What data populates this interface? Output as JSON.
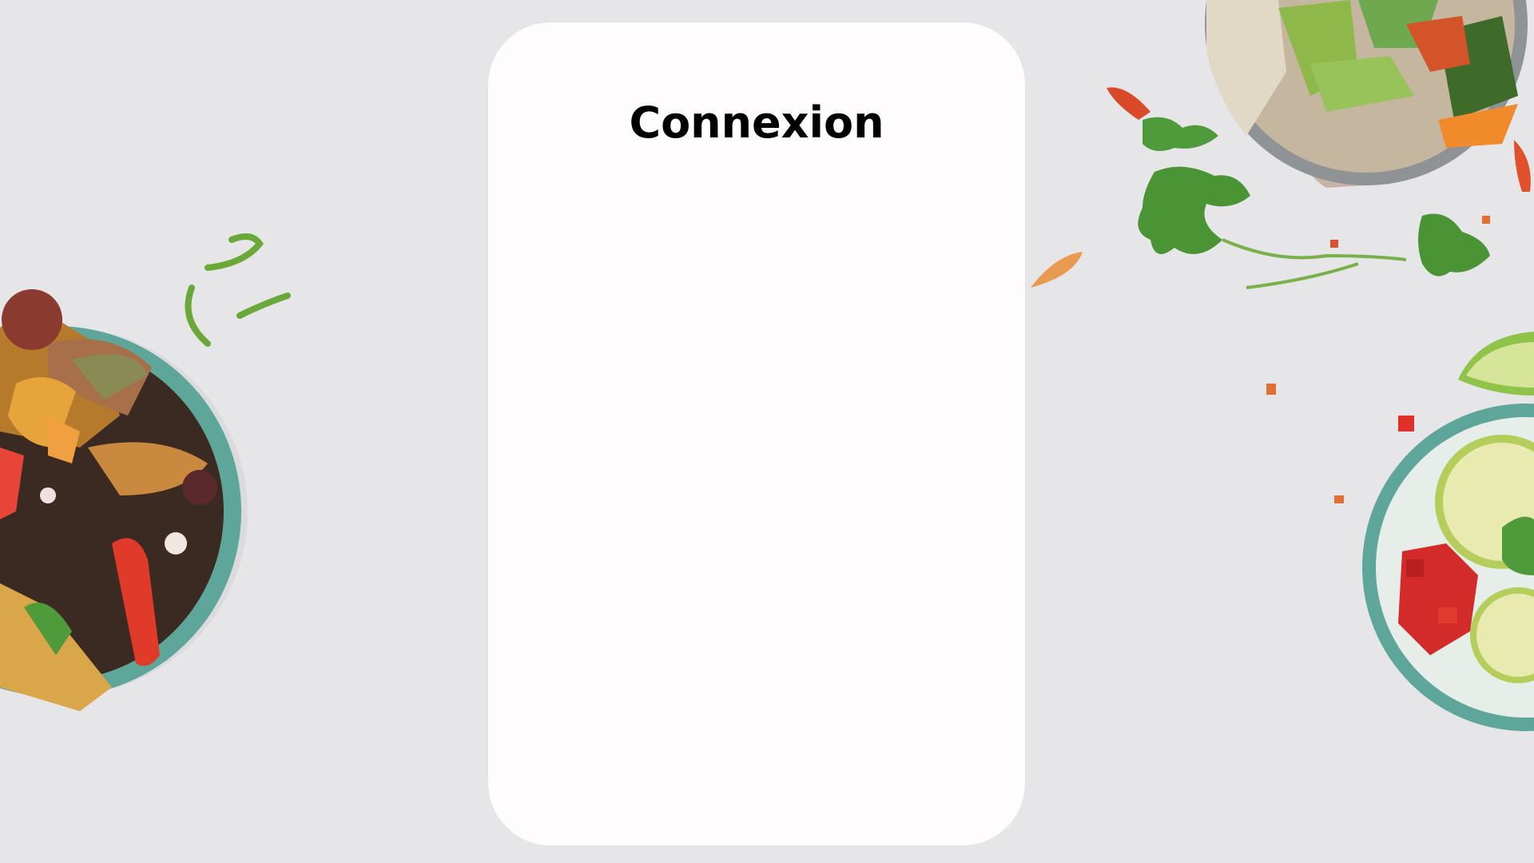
{
  "login": {
    "title": "Connexion"
  },
  "colors": {
    "background": "#e6e5e8",
    "card": "#fefcfd",
    "title": "#000000",
    "bowl_rim": "#6fb8a8",
    "grey_bowl": "#8f9396"
  },
  "decor": {
    "images": [
      "vegetable-bowl-icon",
      "rice-bowl-icon",
      "lime-bowl-icon",
      "cilantro-icon",
      "green-onion-icon"
    ]
  }
}
